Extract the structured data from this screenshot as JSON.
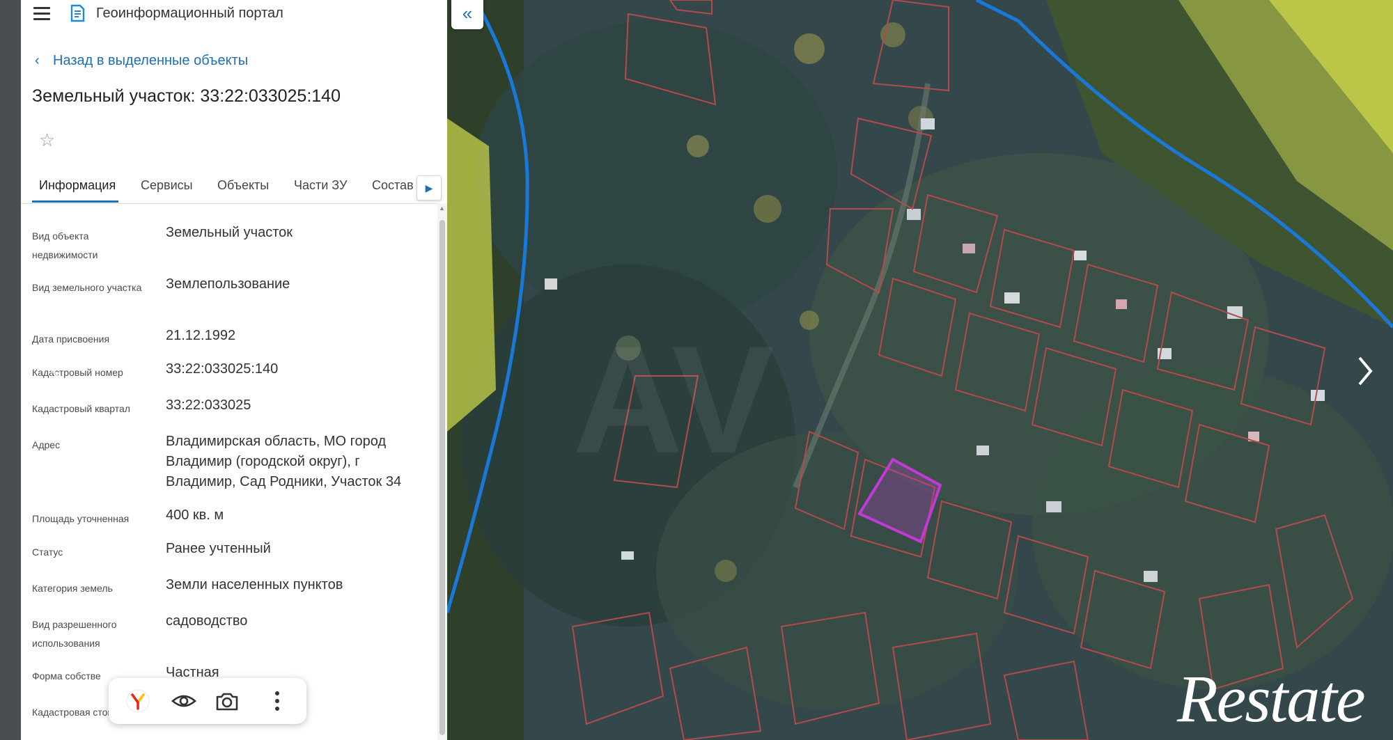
{
  "portal": {
    "title": "Геоинформационный портал"
  },
  "back_link": {
    "label": "Назад в выделенные объекты"
  },
  "object": {
    "title": "Земельный участок: 33:22:033025:140"
  },
  "tabs": [
    {
      "label": "Информация",
      "active": true
    },
    {
      "label": "Сервисы"
    },
    {
      "label": "Объекты"
    },
    {
      "label": "Части ЗУ"
    },
    {
      "label": "Состав"
    }
  ],
  "properties": [
    {
      "label": "Вид объекта недвижимости",
      "value": "Земельный участок"
    },
    {
      "label": "Вид земельного участка",
      "value": "Землепользование"
    },
    {
      "label": "Дата присвоения",
      "value": "21.12.1992"
    },
    {
      "label": "Кадастровый номер",
      "value": "33:22:033025:140"
    },
    {
      "label": "Кадастровый квартал",
      "value": "33:22:033025"
    },
    {
      "label": "Адрес",
      "value": "Владимирская область, МО город Владимир (городской округ), г Владимир, Сад Родники, Участок 34"
    },
    {
      "label": "Площадь уточненная",
      "value": "400 кв. м"
    },
    {
      "label": "Статус",
      "value": "Ранее учтенный"
    },
    {
      "label": "Категория земель",
      "value": "Земли населенных пунктов"
    },
    {
      "label": "Вид разрешенного использования",
      "value": "садоводство"
    },
    {
      "label": "Форма собстве",
      "value": "Частная"
    },
    {
      "label": "Кадастровая стоимость",
      "value": ""
    }
  ],
  "watermark": {
    "text": "Restate"
  },
  "colors": {
    "accent": "#1c6fb3",
    "boundary_line": "#1a78d8",
    "highlight_parcel": "#c23ad6",
    "parcel_outline": "#b44a4a",
    "zone_fill": "#c8d24a"
  },
  "icons": {
    "menu": "hamburger-icon",
    "portal": "portal-logo-icon",
    "favorite": "star-icon",
    "collapse": "double-chevron-left-icon",
    "toolbar": [
      "yandex-icon",
      "eye-icon",
      "camera-icon",
      "more-vertical-icon"
    ]
  }
}
